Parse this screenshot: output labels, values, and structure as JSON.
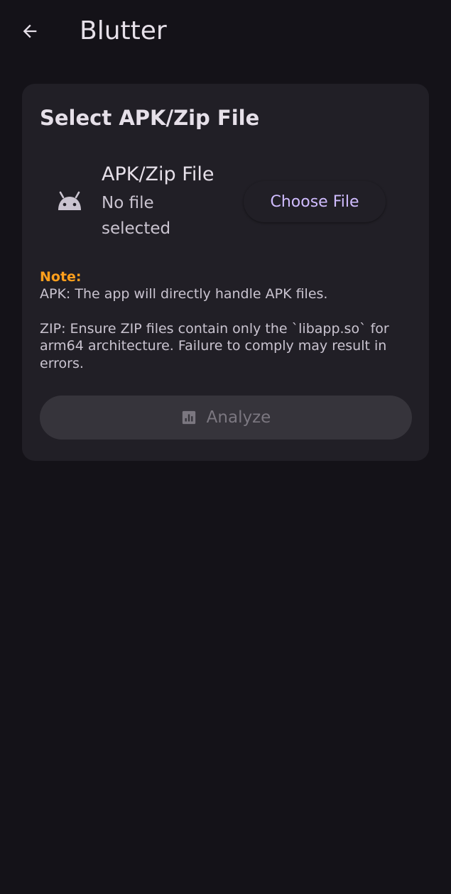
{
  "app_bar": {
    "back_icon": "arrow-left-icon",
    "title": "Blutter"
  },
  "card": {
    "title": "Select APK/Zip File",
    "file_icon": "android-icon",
    "file_label": "APK/Zip File",
    "file_status": "No file selected",
    "choose_button_label": "Choose File",
    "note": {
      "title": "Note:",
      "apk_text": "APK: The app will directly handle APK files.",
      "zip_text": "ZIP: Ensure ZIP files contain only the `libapp.so` for arm64 architecture. Failure to comply may result in errors."
    },
    "analyze_icon": "bar-chart-icon",
    "analyze_button_label": "Analyze",
    "analyze_enabled": false
  },
  "colors": {
    "background": "#141218",
    "card": "#211F26",
    "accent": "#D0BCFF",
    "note": "#FF9F1C",
    "disabled_button": "#36343B",
    "disabled_text": "#7B7780"
  }
}
